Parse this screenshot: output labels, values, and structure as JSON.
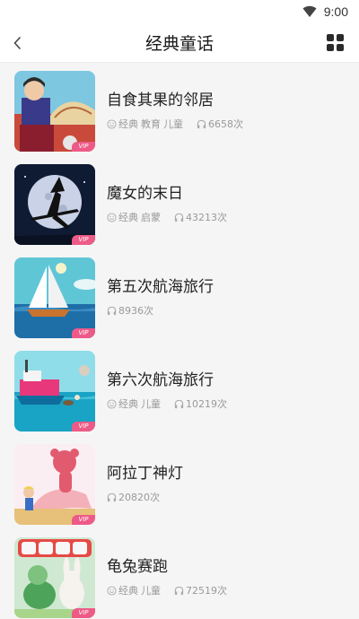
{
  "status_bar": {
    "time": "9:00"
  },
  "header": {
    "title": "经典童话"
  },
  "items": [
    {
      "title": "自食其果的邻居",
      "tags": [
        "经典",
        "教育",
        "儿童"
      ],
      "plays": "6658次",
      "badge": "VIP"
    },
    {
      "title": "魔女的末日",
      "tags": [
        "经典",
        "启蒙"
      ],
      "plays": "43213次",
      "badge": "VIP"
    },
    {
      "title": "第五次航海旅行",
      "tags": [],
      "plays": "8936次",
      "badge": "VIP"
    },
    {
      "title": "第六次航海旅行",
      "tags": [
        "经典",
        "儿童"
      ],
      "plays": "10219次",
      "badge": "VIP"
    },
    {
      "title": "阿拉丁神灯",
      "tags": [],
      "plays": "20820次",
      "badge": "VIP"
    },
    {
      "title": "龟兔赛跑",
      "tags": [
        "经典",
        "儿童"
      ],
      "plays": "72519次",
      "badge": "VIP"
    }
  ],
  "icons": {
    "status": [
      "wifi-icon"
    ],
    "header": [
      "back-chevron-icon",
      "grid-menu-icon"
    ],
    "meta": [
      "smiley-icon",
      "headphones-icon"
    ]
  },
  "colors": {
    "vip_badge": "#ee5a87",
    "meta_text": "#999999"
  }
}
